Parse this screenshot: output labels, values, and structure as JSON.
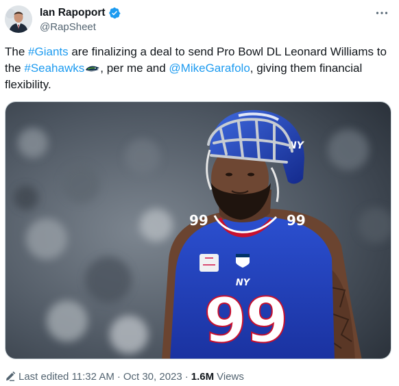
{
  "author": {
    "display_name": "Ian Rapoport",
    "handle": "@RapSheet",
    "verified": true,
    "avatar_icon": "profile-photo"
  },
  "tweet": {
    "parts": [
      {
        "type": "text",
        "value": "The "
      },
      {
        "type": "link",
        "value": "#Giants"
      },
      {
        "type": "text",
        "value": " are finalizing a deal to send Pro Bowl DL Leonard Williams to the "
      },
      {
        "type": "link",
        "value": "#Seahawks"
      },
      {
        "type": "emoji",
        "value": "seahawks-hashflag-icon"
      },
      {
        "type": "text",
        "value": ", per me and "
      },
      {
        "type": "link",
        "value": "@MikeGarafolo"
      },
      {
        "type": "text",
        "value": ", giving them financial flexibility."
      }
    ]
  },
  "media": {
    "jersey_number": "99",
    "team_logo": "NY"
  },
  "footer": {
    "edited_label": "Last edited",
    "time": "11:32 AM",
    "date": "Oct 30, 2023",
    "views_count": "1.6M",
    "views_label": "Views"
  },
  "colors": {
    "link": "#1d9bf0",
    "verified": "#1d9bf0",
    "secondary_text": "#536471",
    "jersey_blue": "#1f3fb0"
  }
}
